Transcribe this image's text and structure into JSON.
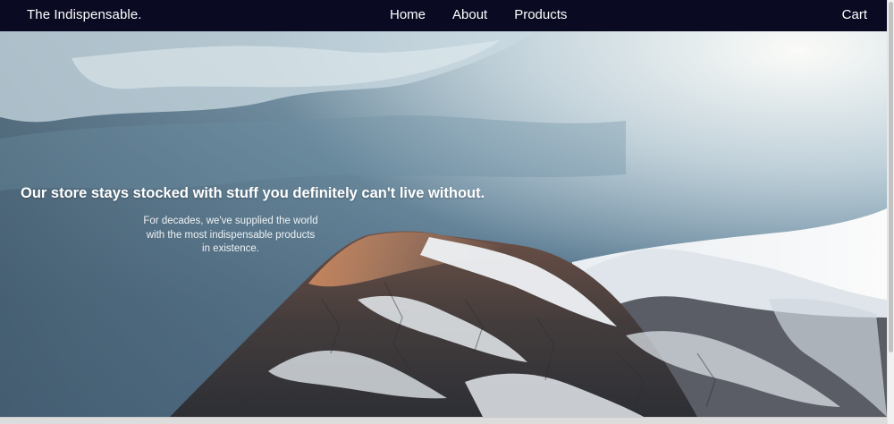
{
  "navbar": {
    "brand": "The Indispensable.",
    "links": [
      {
        "label": "Home"
      },
      {
        "label": "About"
      },
      {
        "label": "Products"
      }
    ],
    "cart_label": "Cart",
    "background_color": "#0a0a23"
  },
  "hero": {
    "heading": "Our store stays stocked with stuff you definitely can't live without.",
    "subtext": "For decades, we've supplied the world with the most indispensable products in existence.",
    "image": "snowy-mountain-peak-under-clouds"
  }
}
